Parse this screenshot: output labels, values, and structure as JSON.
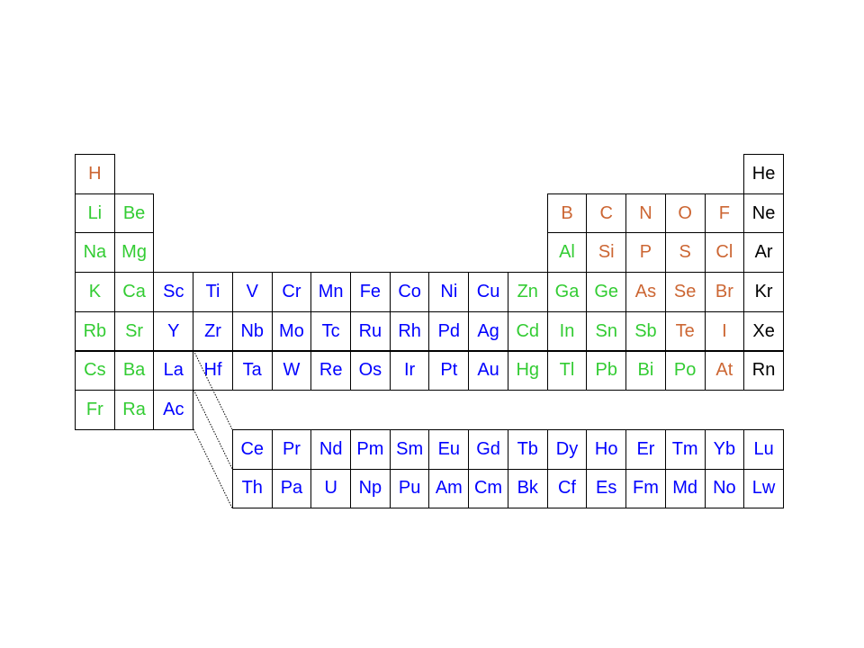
{
  "colors": {
    "orange": "#cc6633",
    "green": "#33cc33",
    "blue": "#0000ff",
    "black": "#000000"
  },
  "main_table": [
    {
      "row": 1,
      "col": 1,
      "symbol": "H",
      "color": "orange"
    },
    {
      "row": 1,
      "col": 18,
      "symbol": "He",
      "color": "black"
    },
    {
      "row": 2,
      "col": 1,
      "symbol": "Li",
      "color": "green"
    },
    {
      "row": 2,
      "col": 2,
      "symbol": "Be",
      "color": "green"
    },
    {
      "row": 2,
      "col": 13,
      "symbol": "B",
      "color": "orange"
    },
    {
      "row": 2,
      "col": 14,
      "symbol": "C",
      "color": "orange"
    },
    {
      "row": 2,
      "col": 15,
      "symbol": "N",
      "color": "orange"
    },
    {
      "row": 2,
      "col": 16,
      "symbol": "O",
      "color": "orange"
    },
    {
      "row": 2,
      "col": 17,
      "symbol": "F",
      "color": "orange"
    },
    {
      "row": 2,
      "col": 18,
      "symbol": "Ne",
      "color": "black"
    },
    {
      "row": 3,
      "col": 1,
      "symbol": "Na",
      "color": "green"
    },
    {
      "row": 3,
      "col": 2,
      "symbol": "Mg",
      "color": "green"
    },
    {
      "row": 3,
      "col": 13,
      "symbol": "Al",
      "color": "green"
    },
    {
      "row": 3,
      "col": 14,
      "symbol": "Si",
      "color": "orange"
    },
    {
      "row": 3,
      "col": 15,
      "symbol": "P",
      "color": "orange"
    },
    {
      "row": 3,
      "col": 16,
      "symbol": "S",
      "color": "orange"
    },
    {
      "row": 3,
      "col": 17,
      "symbol": "Cl",
      "color": "orange"
    },
    {
      "row": 3,
      "col": 18,
      "symbol": "Ar",
      "color": "black"
    },
    {
      "row": 4,
      "col": 1,
      "symbol": "K",
      "color": "green"
    },
    {
      "row": 4,
      "col": 2,
      "symbol": "Ca",
      "color": "green"
    },
    {
      "row": 4,
      "col": 3,
      "symbol": "Sc",
      "color": "blue"
    },
    {
      "row": 4,
      "col": 4,
      "symbol": "Ti",
      "color": "blue"
    },
    {
      "row": 4,
      "col": 5,
      "symbol": "V",
      "color": "blue"
    },
    {
      "row": 4,
      "col": 6,
      "symbol": "Cr",
      "color": "blue"
    },
    {
      "row": 4,
      "col": 7,
      "symbol": "Mn",
      "color": "blue"
    },
    {
      "row": 4,
      "col": 8,
      "symbol": "Fe",
      "color": "blue"
    },
    {
      "row": 4,
      "col": 9,
      "symbol": "Co",
      "color": "blue"
    },
    {
      "row": 4,
      "col": 10,
      "symbol": "Ni",
      "color": "blue"
    },
    {
      "row": 4,
      "col": 11,
      "symbol": "Cu",
      "color": "blue"
    },
    {
      "row": 4,
      "col": 12,
      "symbol": "Zn",
      "color": "green"
    },
    {
      "row": 4,
      "col": 13,
      "symbol": "Ga",
      "color": "green"
    },
    {
      "row": 4,
      "col": 14,
      "symbol": "Ge",
      "color": "green"
    },
    {
      "row": 4,
      "col": 15,
      "symbol": "As",
      "color": "orange"
    },
    {
      "row": 4,
      "col": 16,
      "symbol": "Se",
      "color": "orange"
    },
    {
      "row": 4,
      "col": 17,
      "symbol": "Br",
      "color": "orange"
    },
    {
      "row": 4,
      "col": 18,
      "symbol": "Kr",
      "color": "black"
    },
    {
      "row": 5,
      "col": 1,
      "symbol": "Rb",
      "color": "green"
    },
    {
      "row": 5,
      "col": 2,
      "symbol": "Sr",
      "color": "green"
    },
    {
      "row": 5,
      "col": 3,
      "symbol": "Y",
      "color": "blue"
    },
    {
      "row": 5,
      "col": 4,
      "symbol": "Zr",
      "color": "blue"
    },
    {
      "row": 5,
      "col": 5,
      "symbol": "Nb",
      "color": "blue"
    },
    {
      "row": 5,
      "col": 6,
      "symbol": "Mo",
      "color": "blue"
    },
    {
      "row": 5,
      "col": 7,
      "symbol": "Tc",
      "color": "blue"
    },
    {
      "row": 5,
      "col": 8,
      "symbol": "Ru",
      "color": "blue"
    },
    {
      "row": 5,
      "col": 9,
      "symbol": "Rh",
      "color": "blue"
    },
    {
      "row": 5,
      "col": 10,
      "symbol": "Pd",
      "color": "blue"
    },
    {
      "row": 5,
      "col": 11,
      "symbol": "Ag",
      "color": "blue"
    },
    {
      "row": 5,
      "col": 12,
      "symbol": "Cd",
      "color": "green"
    },
    {
      "row": 5,
      "col": 13,
      "symbol": "In",
      "color": "green"
    },
    {
      "row": 5,
      "col": 14,
      "symbol": "Sn",
      "color": "green"
    },
    {
      "row": 5,
      "col": 15,
      "symbol": "Sb",
      "color": "green"
    },
    {
      "row": 5,
      "col": 16,
      "symbol": "Te",
      "color": "orange"
    },
    {
      "row": 5,
      "col": 17,
      "symbol": "I",
      "color": "orange"
    },
    {
      "row": 5,
      "col": 18,
      "symbol": "Xe",
      "color": "black"
    },
    {
      "row": 6,
      "col": 1,
      "symbol": "Cs",
      "color": "green"
    },
    {
      "row": 6,
      "col": 2,
      "symbol": "Ba",
      "color": "green"
    },
    {
      "row": 6,
      "col": 3,
      "symbol": "La",
      "color": "blue"
    },
    {
      "row": 6,
      "col": 4,
      "symbol": "Hf",
      "color": "blue"
    },
    {
      "row": 6,
      "col": 5,
      "symbol": "Ta",
      "color": "blue"
    },
    {
      "row": 6,
      "col": 6,
      "symbol": "W",
      "color": "blue"
    },
    {
      "row": 6,
      "col": 7,
      "symbol": "Re",
      "color": "blue"
    },
    {
      "row": 6,
      "col": 8,
      "symbol": "Os",
      "color": "blue"
    },
    {
      "row": 6,
      "col": 9,
      "symbol": "Ir",
      "color": "blue"
    },
    {
      "row": 6,
      "col": 10,
      "symbol": "Pt",
      "color": "blue"
    },
    {
      "row": 6,
      "col": 11,
      "symbol": "Au",
      "color": "blue"
    },
    {
      "row": 6,
      "col": 12,
      "symbol": "Hg",
      "color": "green"
    },
    {
      "row": 6,
      "col": 13,
      "symbol": "Tl",
      "color": "green"
    },
    {
      "row": 6,
      "col": 14,
      "symbol": "Pb",
      "color": "green"
    },
    {
      "row": 6,
      "col": 15,
      "symbol": "Bi",
      "color": "green"
    },
    {
      "row": 6,
      "col": 16,
      "symbol": "Po",
      "color": "green"
    },
    {
      "row": 6,
      "col": 17,
      "symbol": "At",
      "color": "orange"
    },
    {
      "row": 6,
      "col": 18,
      "symbol": "Rn",
      "color": "black"
    },
    {
      "row": 7,
      "col": 1,
      "symbol": "Fr",
      "color": "green"
    },
    {
      "row": 7,
      "col": 2,
      "symbol": "Ra",
      "color": "green"
    },
    {
      "row": 7,
      "col": 3,
      "symbol": "Ac",
      "color": "blue"
    }
  ],
  "lanthanides": [
    "Ce",
    "Pr",
    "Nd",
    "Pm",
    "Sm",
    "Eu",
    "Gd",
    "Tb",
    "Dy",
    "Ho",
    "Er",
    "Tm",
    "Yb",
    "Lu"
  ],
  "actinides": [
    "Th",
    "Pa",
    "U",
    "Np",
    "Pu",
    "Am",
    "Cm",
    "Bk",
    "Cf",
    "Es",
    "Fm",
    "Md",
    "No",
    "Lw"
  ],
  "f_block_color": "blue"
}
